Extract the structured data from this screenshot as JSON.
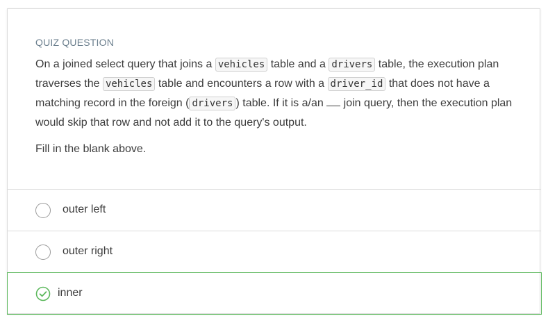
{
  "question": {
    "label": "QUIZ QUESTION",
    "stem": {
      "t1": "On a joined select query that joins a ",
      "c1": "vehicles",
      "t2": " table and a ",
      "c2": "drivers",
      "t3": " table, the execution plan traverses the ",
      "c3": "vehicles",
      "t4": " table and encounters a row with a ",
      "c4": "driver_id",
      "t5": " that does not have a matching record in the foreign (",
      "c5": "drivers",
      "t6": ") table. If it is a/an ",
      "t7": " join query, then the execution plan would skip that row and not add it to the query's output."
    },
    "prompt": "Fill in the blank above."
  },
  "options": [
    {
      "label": "outer left",
      "state": "unselected"
    },
    {
      "label": "outer right",
      "state": "unselected"
    },
    {
      "label": "inner",
      "state": "correct",
      "icon": "check-circle-icon"
    }
  ],
  "colors": {
    "correct": "#5cb85c",
    "label": "#6b7f8e",
    "border": "#dcdcdc"
  }
}
